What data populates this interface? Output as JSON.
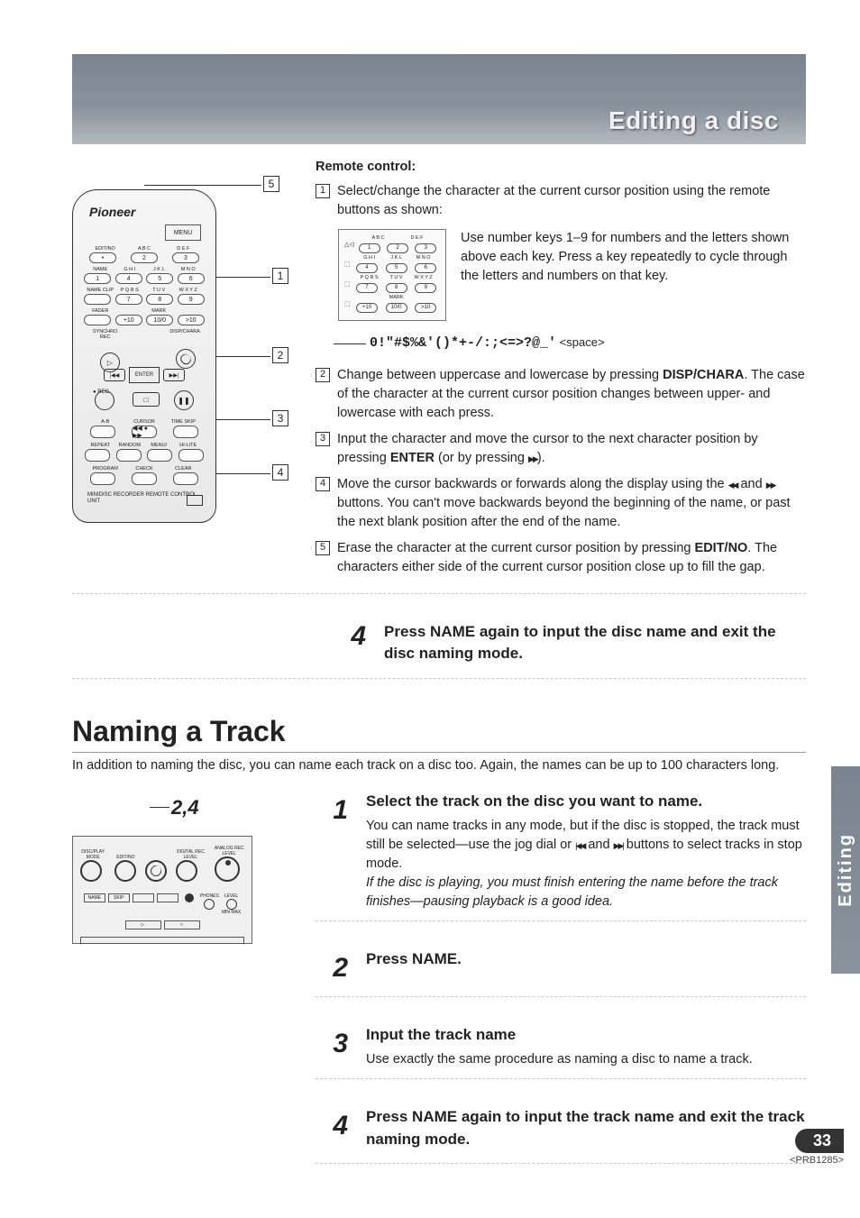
{
  "header": {
    "title": "Editing a disc"
  },
  "remote_diagram": {
    "brand": "Pioneer",
    "display": "MENU",
    "row_labels_1": [
      "EDIT/NO",
      "A B C",
      "D E F"
    ],
    "row_1": [
      "•",
      "2",
      "3"
    ],
    "row_labels_2": [
      "NAME",
      "G H I",
      "J K L",
      "M N O"
    ],
    "row_2": [
      "1",
      "4",
      "5",
      "6"
    ],
    "row_labels_3": [
      "NAME CLIP",
      "P Q R S",
      "T U V",
      "W X Y Z"
    ],
    "row_3": [
      "",
      "7",
      "8",
      "9"
    ],
    "row_labels_4": [
      "FADER",
      "",
      "MARK",
      ""
    ],
    "row_4": [
      "",
      "+10",
      "10/0",
      ">10"
    ],
    "labels_transport_top": [
      "SYNCHRO REC",
      "",
      "DISP/CHARA"
    ],
    "play": "▷",
    "enter": "ENTER",
    "left_arrow": "|◀◀",
    "right_arrow": "▶▶|",
    "rec_label": "● REC",
    "stop": "□",
    "pause_label": "",
    "lower_labels_1": [
      "A-B",
      "CURSOR",
      "TIME SKIP"
    ],
    "lower_row_1": [
      "",
      "◀◀ ● ▶▶",
      ""
    ],
    "lower_labels_2": [
      "REPEAT",
      "RANDOM",
      "MENU/​",
      "HI-LITE"
    ],
    "lower_row_2": [
      "",
      "",
      "",
      ""
    ],
    "lower_labels_3": [
      "PROGRAM",
      "CHECK",
      "CLEAR"
    ],
    "lower_row_3": [
      "",
      "",
      ""
    ],
    "footer": "MINIDISC RECORDER\nREMOTE CONTROL UNIT",
    "callouts": [
      "5",
      "1",
      "2",
      "3",
      "4"
    ]
  },
  "remote_section": {
    "heading": "Remote control:",
    "step1": "Select/change the character at the current cursor position using the remote buttons as shown:",
    "keypad_text": "Use number keys 1–9 for numbers and the letters shown above each key. Press a key repeatedly to cycle through the letters and numbers on that key.",
    "keypad_labels_1": [
      "",
      "A B C",
      "D E F"
    ],
    "keypad_row_1": [
      "1",
      "2",
      "3"
    ],
    "keypad_labels_2": [
      "",
      "G H I",
      "J K L",
      "M N O"
    ],
    "keypad_row_2": [
      "4",
      "5",
      "6"
    ],
    "keypad_labels_3": [
      "",
      "P Q R S",
      "T U V",
      "W X Y Z"
    ],
    "keypad_row_3": [
      "7",
      "8",
      "9"
    ],
    "keypad_labels_4": [
      "",
      "",
      "MARK",
      ""
    ],
    "keypad_row_4": [
      "+10",
      "10/0",
      ">10"
    ],
    "keypad_side": [
      "△◁",
      "⬚",
      "⬚",
      "⬚"
    ],
    "symbols": "0!\"#$%&'()*+-/:;<=>?@_'",
    "symbols_suffix": " <space>",
    "step2_a": "Change between uppercase and lowercase by pressing ",
    "step2_bold": "DISP/CHARA",
    "step2_b": ". The case of the character at the current cursor position changes between upper- and lowercase with each press.",
    "step3_a": "Input the character and move the cursor to the next character position by pressing ",
    "step3_bold": "ENTER",
    "step3_b": " (or by pressing ",
    "step3_c": ").",
    "step4_a": "Move the cursor backwards or forwards along the display using the ",
    "step4_b": " and ",
    "step4_c": " buttons. You can't move backwards beyond the beginning of the name, or past the next blank position after the end of the name.",
    "step5_a": "Erase the character at the current cursor position by pressing ",
    "step5_bold": "EDIT/NO",
    "step5_b": ". The characters either side of the current cursor position close up to fill the gap."
  },
  "big_step4": {
    "num": "4",
    "heading": "Press NAME again to input the disc name and exit the disc naming mode."
  },
  "track_section": {
    "title": "Naming a Track",
    "intro": "In addition to naming the disc, you can name each track on a disc too. Again, the names can be up to 100 characters long.",
    "panel_callout": "2,4",
    "front_panel_labels": [
      "DISC/PLAY MODE",
      "EDIT/NO",
      "",
      "DIGITAL REC LEVEL",
      "ANALOG REC LEVEL"
    ],
    "front_panel_btns": [
      "NAME",
      "SKIP",
      "",
      "",
      "●",
      ""
    ],
    "phones_label": "PHONES",
    "level_label": "LEVEL",
    "min_max": "MIN    MAX",
    "steps": [
      {
        "num": "1",
        "heading": "Select the track on the disc you want to name.",
        "body_a": "You can name tracks in any mode, but if the disc is stopped, the track must still be selected—use the jog dial or ",
        "body_b": " and ",
        "body_c": " buttons to select tracks in stop mode.",
        "italic": "If the disc is playing, you must finish entering the name before the track finishes—pausing playback is a good idea."
      },
      {
        "num": "2",
        "heading": "Press NAME."
      },
      {
        "num": "3",
        "heading": "Input the track name",
        "body": "Use exactly the same procedure as naming a disc to name a track."
      },
      {
        "num": "4",
        "heading": "Press NAME again to input the track name and exit the track naming mode."
      }
    ]
  },
  "side_tab": "Editing",
  "page_number": "33",
  "doc_code": "<PRB1285>"
}
